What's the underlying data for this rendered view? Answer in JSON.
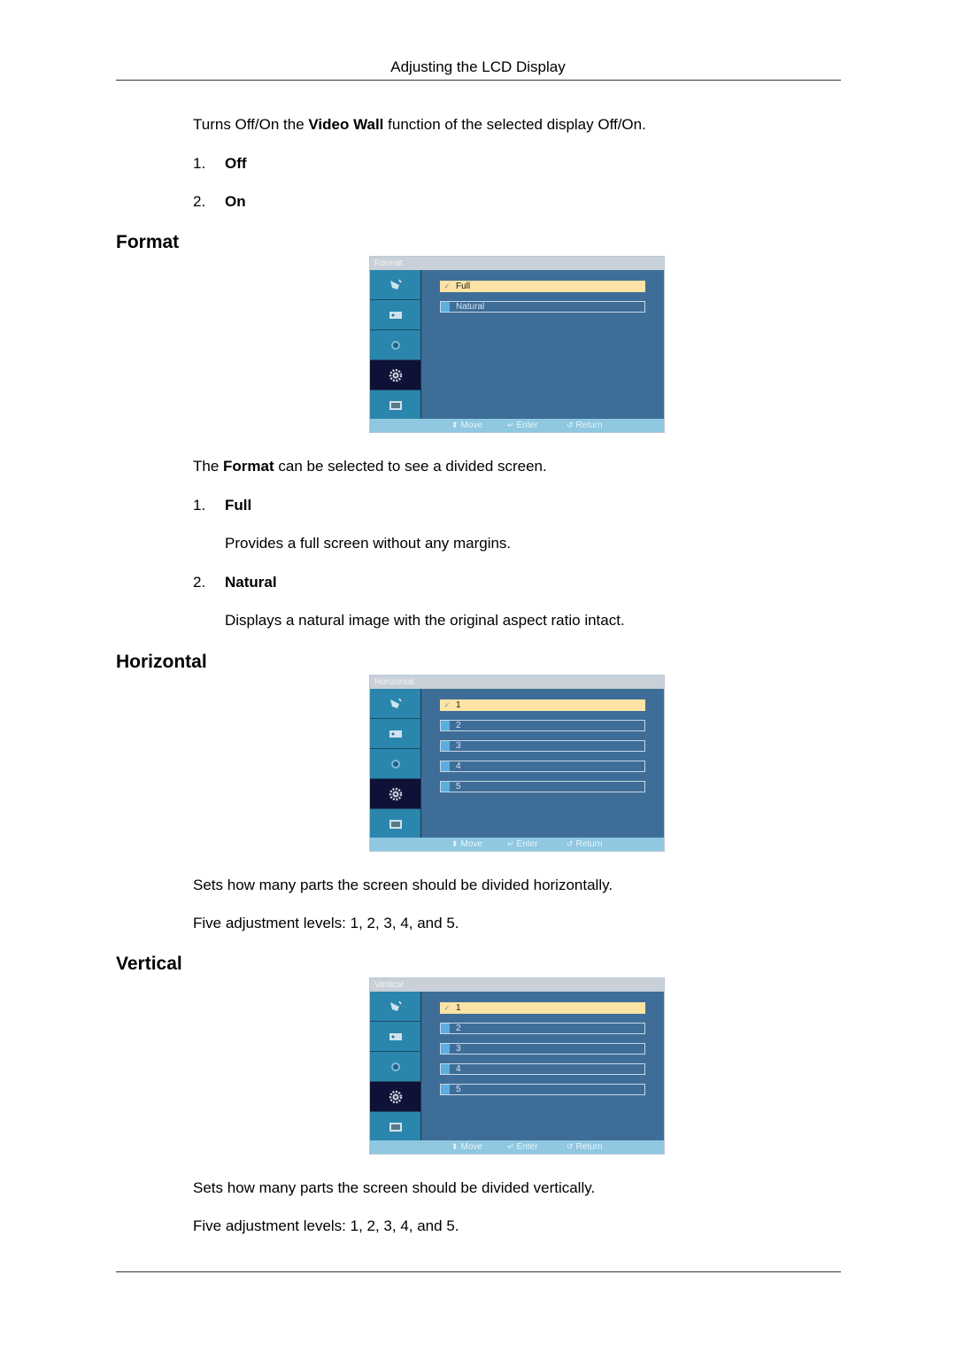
{
  "header": {
    "title": "Adjusting the LCD Display"
  },
  "intro": {
    "text_before": "Turns Off/On the ",
    "text_bold": "Video Wall",
    "text_after": " function of the selected display Off/On.",
    "options": [
      {
        "num": "1.",
        "label": "Off"
      },
      {
        "num": "2.",
        "label": "On"
      }
    ]
  },
  "sections": {
    "format": {
      "heading": "Format",
      "menu": {
        "title": "Format",
        "items": [
          {
            "label": "Full",
            "selected": true,
            "check": "✓"
          },
          {
            "label": "Natural",
            "selected": false
          }
        ],
        "footer": {
          "move": "Move",
          "enter": "Enter",
          "return": "Return"
        }
      },
      "desc_before": "The ",
      "desc_bold": "Format",
      "desc_after": " can be selected to see a divided screen.",
      "options": [
        {
          "num": "1.",
          "label": "Full",
          "desc": "Provides a full screen without any margins."
        },
        {
          "num": "2.",
          "label": "Natural",
          "desc": "Displays a natural image with the original aspect ratio intact."
        }
      ]
    },
    "horizontal": {
      "heading": "Horizontal",
      "menu": {
        "title": "Horizontal",
        "items": [
          {
            "label": "1",
            "selected": true,
            "check": "✓"
          },
          {
            "label": "2",
            "selected": false
          },
          {
            "label": "3",
            "selected": false
          },
          {
            "label": "4",
            "selected": false
          },
          {
            "label": "5",
            "selected": false
          }
        ],
        "footer": {
          "move": "Move",
          "enter": "Enter",
          "return": "Return"
        }
      },
      "desc": "Sets how many parts the screen should be divided horizontally.",
      "levels": "Five adjustment levels: 1, 2, 3, 4, and 5."
    },
    "vertical": {
      "heading": "Vertical",
      "menu": {
        "title": "Vertical",
        "items": [
          {
            "label": "1",
            "selected": true,
            "check": "✓"
          },
          {
            "label": "2",
            "selected": false
          },
          {
            "label": "3",
            "selected": false
          },
          {
            "label": "4",
            "selected": false
          },
          {
            "label": "5",
            "selected": false
          }
        ],
        "footer": {
          "move": "Move",
          "enter": "Enter",
          "return": "Return"
        }
      },
      "desc": "Sets how many parts the screen should be divided vertically.",
      "levels": "Five adjustment levels: 1, 2, 3, 4, and 5."
    }
  },
  "colors": {
    "osd_bg": "#3e6e98",
    "osd_tab": "#2a86ac",
    "osd_tab_active": "#0e1236",
    "osd_selected": "#fde3a6",
    "osd_footer": "#8fc8e0",
    "osd_title_bar": "#c9d0d8"
  }
}
